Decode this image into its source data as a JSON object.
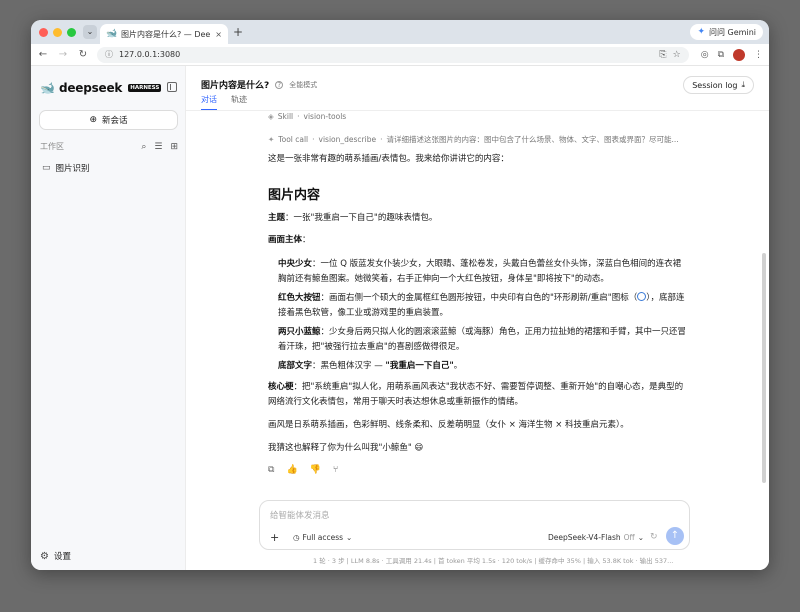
{
  "browser": {
    "tab_title": "图片内容是什么? — DeepSeek…",
    "tab_close": "×",
    "new_tab": "+",
    "url": "127.0.0.1:3080",
    "gemini_label": "问问 Gemini"
  },
  "sidebar": {
    "brand_name": "deepseek",
    "brand_badge": "HARNESS",
    "new_chat_label": "新会话",
    "workspace_label": "工作区",
    "folders": [
      "图片识别"
    ],
    "settings_label": "设置"
  },
  "header": {
    "title": "图片内容是什么?",
    "mode": "全能模式",
    "tabs": [
      "对话",
      "轨迹"
    ],
    "session_log": "Session log"
  },
  "message": {
    "skill_label": "Skill",
    "skill_name": "vision-tools",
    "tool_label": "Tool call",
    "tool_name": "vision_describe",
    "tool_args": "请详细描述这张图片的内容：图中包含了什么场景、物体、文字、图表或界面？尽可能...",
    "intro": "这是一张非常有趣的萌系插画/表情包。我来给你讲讲它的内容：",
    "heading": "图片内容",
    "theme_label": "主题",
    "theme_text": "：一张\"我重启一下自己\"的趣味表情包。",
    "subject_label": "画面主体",
    "subject_suffix": "：",
    "items": [
      {
        "label": "中央少女",
        "text": "：一位 Q 版蓝发女仆装少女，大眼睛、蓬松卷发，头戴白色蕾丝女仆头饰，深蓝白色相间的连衣裙胸前还有鲸鱼图案。她微笑着，右手正伸向一个大红色按钮，身体呈\"即将按下\"的动态。"
      },
      {
        "label": "红色大按钮",
        "text": "：画面右侧一个硕大的金属框红色圆形按钮，中央印有白色的\"环形刷新/重启\"图标（",
        "text2": "），底部连接着黑色软管，像工业或游戏里的重启装置。"
      },
      {
        "label": "两只小蓝鲸",
        "text": "：少女身后两只拟人化的圆滚滚蓝鲸（或海豚）角色，正用力拉扯她的裙摆和手臂，其中一只还冒着汗珠，把\"被强行拉去重启\"的喜剧感做得很足。"
      },
      {
        "label": "底部文字",
        "text": "：黑色粗体汉字 — ",
        "bold": "\"我重启一下自己\"",
        "end": "。"
      }
    ],
    "core_label": "核心梗",
    "core_text": "：把\"系统重启\"拟人化，用萌系画风表达\"我状态不好、需要暂停调整、重新开始\"的自嘲心态，是典型的网络流行文化表情包，常用于聊天时表达想休息或重新振作的情绪。",
    "style_text": "画风是日系萌系插画，色彩鲜明、线条柔和、反差萌明显（女仆 × 海洋生物 × 科技重启元素）。",
    "guess_text": "我猜这也解释了你为什么叫我\"小鲸鱼\" 😄"
  },
  "composer": {
    "placeholder": "给智能体发消息",
    "access": "Full access",
    "model": "DeepSeek-V4-Flash",
    "model_state": "Off"
  },
  "status": "1 轮 · 3 步  |  LLM 8.8s · 工具调用 21.4s  |  首 token 平均 1.5s · 120 tok/s  |  缓存命中 35%  |  输入 53.8K tok · 输出 537..."
}
